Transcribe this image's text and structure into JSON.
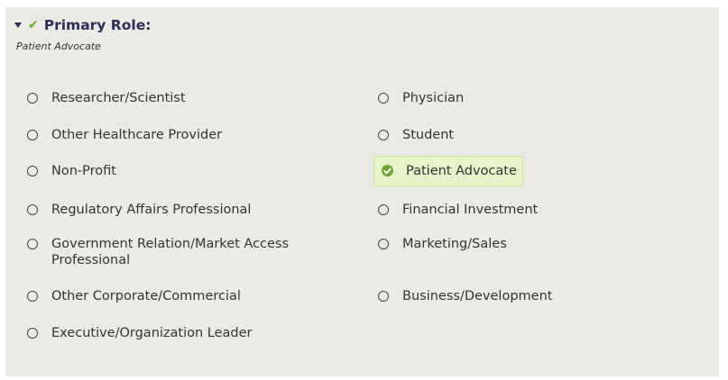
{
  "section": {
    "title": "Primary Role:",
    "current_value": "Patient Advocate",
    "expand_icon": "caret-down-icon",
    "status_icon": "checkmark-icon",
    "status_color": "#6aaa2e"
  },
  "options": [
    {
      "label": "Researcher/Scientist",
      "selected": false
    },
    {
      "label": "Physician",
      "selected": false
    },
    {
      "label": "Other Healthcare Provider",
      "selected": false
    },
    {
      "label": "Student",
      "selected": false
    },
    {
      "label": "Non-Profit",
      "selected": false
    },
    {
      "label": "Patient Advocate",
      "selected": true
    },
    {
      "label": "Regulatory Affairs Professional",
      "selected": false
    },
    {
      "label": "Financial Investment",
      "selected": false
    },
    {
      "label": "Government Relation/Market Access Professional",
      "selected": false
    },
    {
      "label": "Marketing/Sales",
      "selected": false
    },
    {
      "label": "Other Corporate/Commercial",
      "selected": false
    },
    {
      "label": "Business/Development",
      "selected": false
    },
    {
      "label": "Executive/Organization Leader",
      "selected": false
    }
  ],
  "colors": {
    "panel_bg": "#eceae4",
    "title": "#2b2d5a",
    "selected_bg": "#e6f5c9",
    "selected_border": "#c8e69c"
  }
}
